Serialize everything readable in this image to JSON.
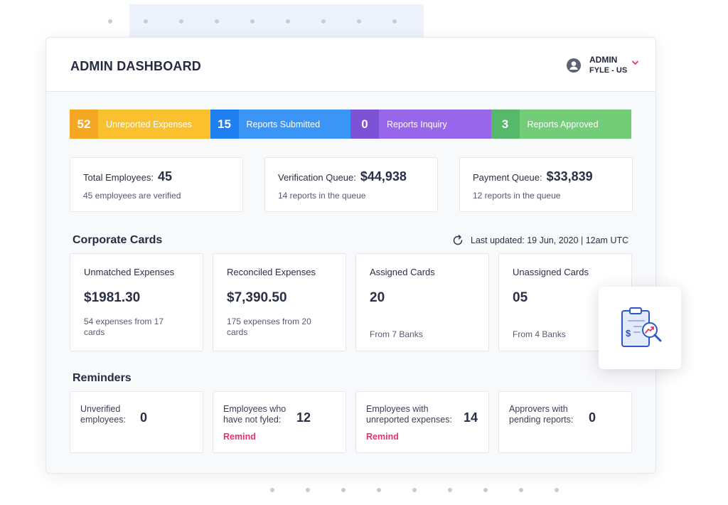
{
  "header": {
    "title": "ADMIN DASHBOARD",
    "user": {
      "name": "ADMIN",
      "org": "FYLE - US",
      "avatar_icon": "user-circle-icon",
      "dropdown_icon": "chevron-down-icon"
    }
  },
  "status_bar": [
    {
      "count": "52",
      "label": "Unreported Expenses",
      "count_color": "#f5a623",
      "label_color": "#fbc02d"
    },
    {
      "count": "15",
      "label": "Reports Submitted",
      "count_color": "#1e7ff0",
      "label_color": "#3a95f7"
    },
    {
      "count": "0",
      "label": "Reports Inquiry",
      "count_color": "#7d53d6",
      "label_color": "#9866ea"
    },
    {
      "count": "3",
      "label": "Reports Approved",
      "count_color": "#55b86b",
      "label_color": "#72cc78"
    }
  ],
  "summary": [
    {
      "title": "Total Employees:",
      "value": "45",
      "sub": "45 employees are verified"
    },
    {
      "title": "Verification Queue:",
      "value": "$44,938",
      "sub": "14 reports in the queue"
    },
    {
      "title": "Payment Queue:",
      "value": "$33,839",
      "sub": "12 reports in the queue"
    }
  ],
  "corporate_cards": {
    "title": "Corporate Cards",
    "updated": "Last updated: 19 Jun, 2020 | 12am UTC",
    "refresh_icon": "refresh-icon",
    "cards": [
      {
        "title": "Unmatched Expenses",
        "value": "$1981.30",
        "sub": "54 expenses from 17 cards"
      },
      {
        "title": "Reconciled Expenses",
        "value": "$7,390.50",
        "sub": "175 expenses from 20 cards"
      },
      {
        "title": "Assigned Cards",
        "value": "20",
        "sub": "From 7 Banks"
      },
      {
        "title": "Unassigned Cards",
        "value": "05",
        "sub": "From 4 Banks"
      }
    ]
  },
  "reminders": {
    "title": "Reminders",
    "remind_label": "Remind",
    "items": [
      {
        "label_line1": "Unverified",
        "label_line2": "employees:",
        "value": "0",
        "has_remind": false
      },
      {
        "label_line1": "Employees who",
        "label_line2": "have not fyled:",
        "value": "12",
        "has_remind": true
      },
      {
        "label_line1": "Employees with",
        "label_line2": "unreported expenses:",
        "value": "14",
        "has_remind": true
      },
      {
        "label_line1": "Approvers with",
        "label_line2": "pending reports:",
        "value": "0",
        "has_remind": false
      }
    ]
  },
  "floating_icon": "expense-report-clipboard-icon",
  "colors": {
    "accent_pink": "#e9326d",
    "primary_text": "#2b2f45"
  }
}
